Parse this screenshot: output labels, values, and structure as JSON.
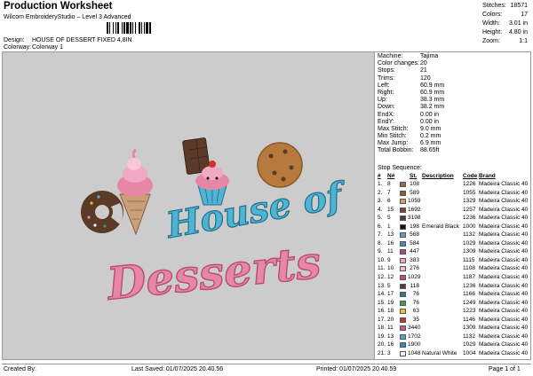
{
  "header": {
    "title": "Production Worksheet",
    "subtitle": "Wilcom EmbroideryStudio – Level 3 Advanced",
    "design_label": "Design:",
    "design_value": "HOUSE OF DESSERT FIXED 4,8IN",
    "colorway_label": "Colorway:",
    "colorway_value": "Colorway 1"
  },
  "top_stats": [
    {
      "label": "Stitches:",
      "value": "18571"
    },
    {
      "label": "Colors:",
      "value": "17"
    },
    {
      "label": "Width:",
      "value": "3.01 in"
    },
    {
      "label": "Height:",
      "value": "4.80 in"
    },
    {
      "label": "Zoom:",
      "value": "1:1"
    }
  ],
  "design_art": {
    "line1": "House of",
    "line2": "Desserts",
    "colors": {
      "background": "#cccccc",
      "pink": "#e886a6",
      "pink_dark": "#b94c74",
      "blue": "#4fb4d4",
      "blue_dark": "#1f6f8c",
      "chocolate": "#5b3a28",
      "cookie": "#b87a3c",
      "cream": "#f6c8d8"
    }
  },
  "machine_info": [
    {
      "k": "Machine:",
      "v": "Tajima"
    },
    {
      "k": "Color changes:",
      "v": "20"
    },
    {
      "k": "Stops:",
      "v": "21"
    },
    {
      "k": "Trims:",
      "v": "120"
    },
    {
      "k": "Left:",
      "v": "60.9 mm"
    },
    {
      "k": "Right:",
      "v": "60.9 mm"
    },
    {
      "k": "Up:",
      "v": "38.3 mm"
    },
    {
      "k": "Down:",
      "v": "38.2 mm"
    },
    {
      "k": "EndX:",
      "v": "0.00 in"
    },
    {
      "k": "EndY:",
      "v": "0.00 in"
    },
    {
      "k": "Max Stitch:",
      "v": "9.0 mm"
    },
    {
      "k": "Min Stitch:",
      "v": "0.2 mm"
    },
    {
      "k": "Max Jump:",
      "v": "6.9 mm"
    },
    {
      "k": "Total Bobbin:",
      "v": "88.65ft"
    }
  ],
  "sequence": {
    "title": "Stop Sequence:",
    "headers": {
      "num": "#",
      "n": "N#",
      "st": "St.",
      "desc": "Description",
      "code": "Code",
      "brand": "Brand"
    },
    "rows": [
      {
        "num": "1.",
        "n": "8",
        "st": "108",
        "desc": "",
        "code": "1226",
        "brand": "Madeira Classic 40",
        "color": "#9b6a4a"
      },
      {
        "num": "2.",
        "n": "7",
        "st": "589",
        "desc": "",
        "code": "1055",
        "brand": "Madeira Classic 40",
        "color": "#8a5a3a"
      },
      {
        "num": "3.",
        "n": "6",
        "st": "1059",
        "desc": "",
        "code": "1329",
        "brand": "Madeira Classic 40",
        "color": "#c9a07a"
      },
      {
        "num": "4.",
        "n": "15",
        "st": "1692",
        "desc": "",
        "code": "1257",
        "brand": "Madeira Classic 40",
        "color": "#6b4a3a"
      },
      {
        "num": "5.",
        "n": "5",
        "st": "3198",
        "desc": "",
        "code": "1236",
        "brand": "Madeira Classic 40",
        "color": "#5a3a3a"
      },
      {
        "num": "6.",
        "n": "1",
        "st": "198",
        "desc": "Emerald Black",
        "code": "1000",
        "brand": "Madeira Classic 40",
        "color": "#111111"
      },
      {
        "num": "7.",
        "n": "13",
        "st": "568",
        "desc": "",
        "code": "1132",
        "brand": "Madeira Classic 40",
        "color": "#5aa0c8"
      },
      {
        "num": "8.",
        "n": "16",
        "st": "584",
        "desc": "",
        "code": "1029",
        "brand": "Madeira Classic 40",
        "color": "#4a8ab8"
      },
      {
        "num": "9.",
        "n": "11",
        "st": "447",
        "desc": "",
        "code": "1309",
        "brand": "Madeira Classic 40",
        "color": "#a84a7a"
      },
      {
        "num": "10.",
        "n": "9",
        "st": "383",
        "desc": "",
        "code": "1115",
        "brand": "Madeira Classic 40",
        "color": "#e8a8c8"
      },
      {
        "num": "11.",
        "n": "10",
        "st": "276",
        "desc": "",
        "code": "1108",
        "brand": "Madeira Classic 40",
        "color": "#f0b8d0"
      },
      {
        "num": "12.",
        "n": "12",
        "st": "1029",
        "desc": "",
        "code": "1187",
        "brand": "Madeira Classic 40",
        "color": "#c84878"
      },
      {
        "num": "13.",
        "n": "5",
        "st": "118",
        "desc": "",
        "code": "1236",
        "brand": "Madeira Classic 40",
        "color": "#5a3a3a"
      },
      {
        "num": "14.",
        "n": "17",
        "st": "76",
        "desc": "",
        "code": "1166",
        "brand": "Madeira Classic 40",
        "color": "#2a7a8a"
      },
      {
        "num": "15.",
        "n": "19",
        "st": "76",
        "desc": "",
        "code": "1249",
        "brand": "Madeira Classic 40",
        "color": "#3aa050"
      },
      {
        "num": "16.",
        "n": "18",
        "st": "63",
        "desc": "",
        "code": "1223",
        "brand": "Madeira Classic 40",
        "color": "#e8c030"
      },
      {
        "num": "17.",
        "n": "20",
        "st": "35",
        "desc": "",
        "code": "1146",
        "brand": "Madeira Classic 40",
        "color": "#d03030"
      },
      {
        "num": "18.",
        "n": "11",
        "st": "3440",
        "desc": "",
        "code": "1309",
        "brand": "Madeira Classic 40",
        "color": "#c85888"
      },
      {
        "num": "19.",
        "n": "13",
        "st": "1702",
        "desc": "",
        "code": "1132",
        "brand": "Madeira Classic 40",
        "color": "#5aa0c8"
      },
      {
        "num": "20.",
        "n": "16",
        "st": "1900",
        "desc": "",
        "code": "1029",
        "brand": "Madeira Classic 40",
        "color": "#3a8ab8"
      },
      {
        "num": "21.",
        "n": "3",
        "st": "1048",
        "desc": "Natural White",
        "code": "1004",
        "brand": "Madeira Classic 40",
        "color": "#f4f4f4"
      }
    ]
  },
  "footer": {
    "created_by": "Created By:",
    "last_saved": "Last Saved: 01/07/2025 20.40.56",
    "printed": "Printed: 01/07/2025 20.40.59",
    "page": "Page 1 of 1"
  }
}
